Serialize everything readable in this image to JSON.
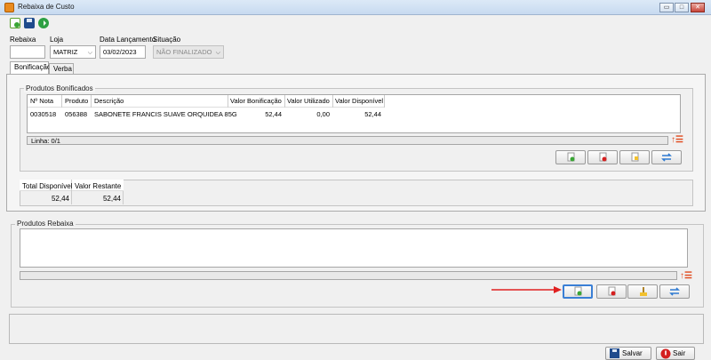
{
  "window": {
    "title": "Rebaixa de Custo",
    "icon": "app-icon"
  },
  "toolbar": {
    "items": [
      "new-document-icon",
      "save-icon",
      "confirm-icon"
    ]
  },
  "filters": {
    "rebaixa_label": "Rebaixa",
    "rebaixa_value": "",
    "loja_label": "Loja",
    "loja_value": "MATRIZ",
    "data_label": "Data Lançamento",
    "data_value": "03/02/2023",
    "situacao_label": "Situação",
    "situacao_value": "NÃO FINALIZADO"
  },
  "tabs": [
    {
      "label": "Bonificação",
      "active": true
    },
    {
      "label": "Verba",
      "active": false
    }
  ],
  "produtos_bonificados": {
    "title": "Produtos Bonificados",
    "columns": [
      "Nº Nota",
      "Produto",
      "Descrição",
      "Valor Bonificação",
      "Valor Utilizado",
      "Valor Disponível"
    ],
    "rows": [
      {
        "nota": "0030518",
        "produto": "056388",
        "descricao": "SABONETE FRANCIS SUAVE ORQUIDEA 85G",
        "valor_bonificacao": "52,44",
        "valor_utilizado": "0,00",
        "valor_disponivel": "52,44"
      }
    ],
    "status": "Linha: 0/1"
  },
  "totais": {
    "total_disponivel_label": "Total Disponível",
    "valor_restante_label": "Valor Restante",
    "total_disponivel": "52,44",
    "valor_restante": "52,44"
  },
  "produtos_rebaixa": {
    "title": "Produtos Rebaixa"
  },
  "footer": {
    "salvar_label": "Salvar",
    "sair_label": "Sair"
  },
  "colors": {
    "accent_arrow": "#e02020",
    "sort_icon": "#e0481c",
    "focus": "#3a7fd5"
  }
}
